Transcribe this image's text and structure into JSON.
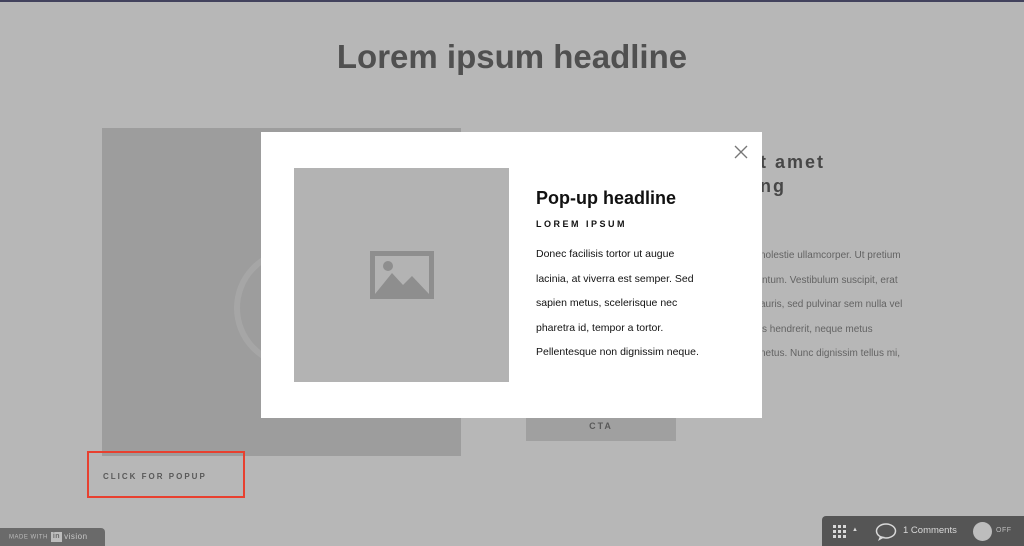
{
  "page": {
    "title": "Lorem ipsum headline",
    "popup_link": "CLICK FOR POPUP",
    "right_heading_lines": [
      "t amet",
      "ng"
    ],
    "right_text_lines": [
      "nolestie ullamcorper. Ut pretium",
      "ntum. Vestibulum suscipit, erat",
      "auris, sed pulvinar sem nulla vel",
      "s hendrerit, neque metus",
      "netus. Nunc dignissim tellus mi,"
    ],
    "cta_label": "CTA"
  },
  "modal": {
    "close_icon": "close-icon",
    "image_icon": "image-placeholder-icon",
    "title": "Pop-up headline",
    "subtitle": "LOREM IPSUM",
    "body_lines": [
      "Donec facilisis tortor ut augue",
      "lacinia, at viverra est semper. Sed",
      "sapien metus, scelerisque nec",
      "pharetra id, tempor a tortor.",
      "Pellentesque non dignissim neque."
    ]
  },
  "footer": {
    "made_with": "MADE WITH",
    "logo_text": "in",
    "brand": "vision",
    "comments_label": "1 Comments",
    "toggle_label": "OFF"
  },
  "colors": {
    "highlight": "#e8402f",
    "overlay": "rgba(95,95,95,0.45)",
    "toolbar": "#555555"
  }
}
